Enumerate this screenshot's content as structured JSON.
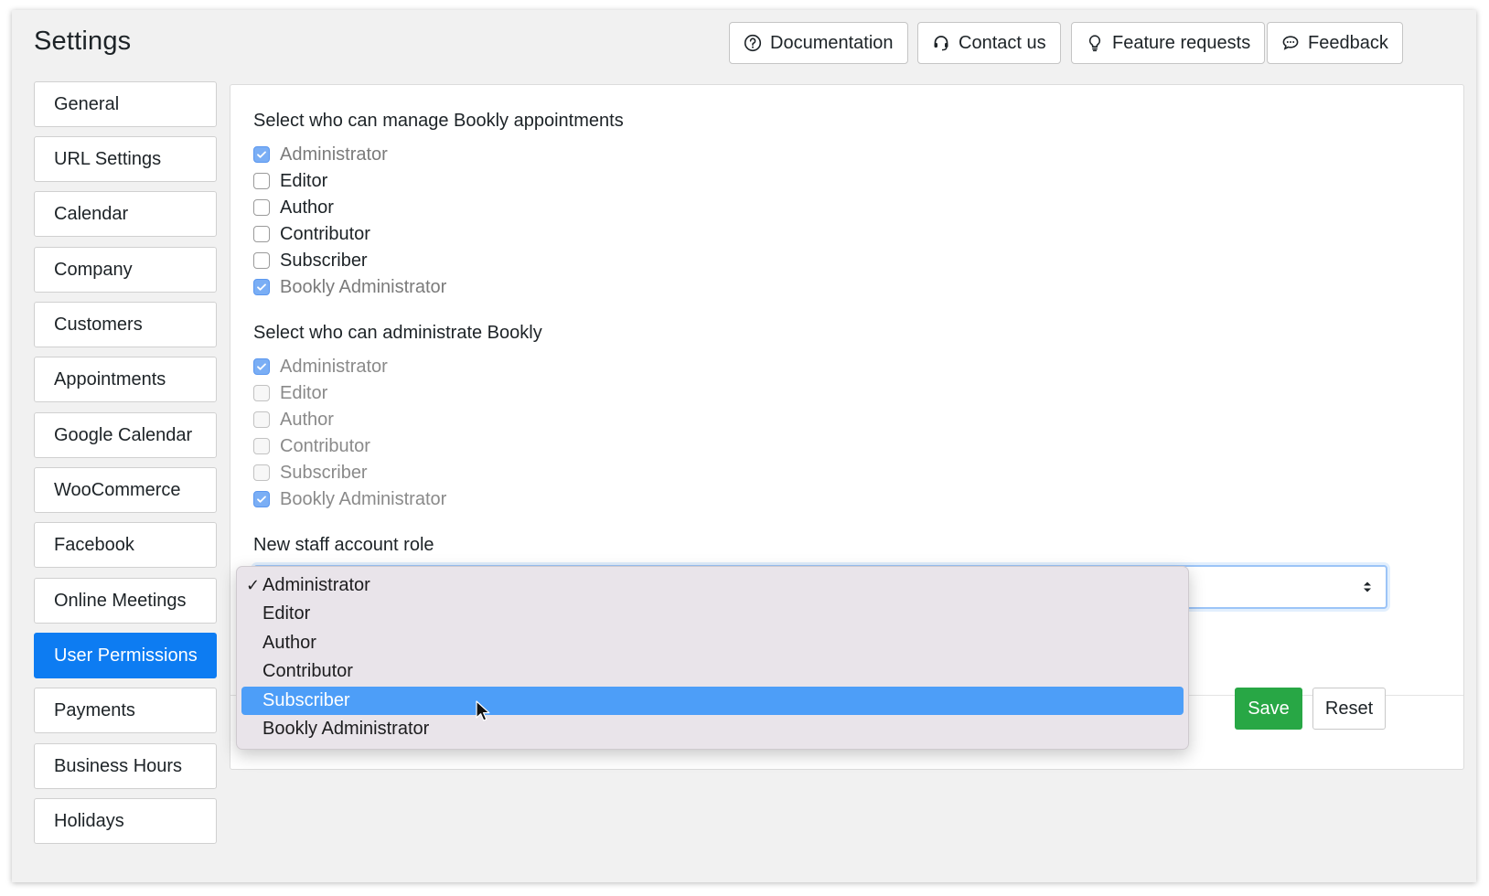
{
  "header": {
    "title": "Settings",
    "buttons": [
      {
        "label": "Documentation",
        "icon": "question-circle-icon"
      },
      {
        "label": "Contact us",
        "icon": "headset-icon"
      },
      {
        "label": "Feature requests",
        "icon": "lightbulb-icon"
      },
      {
        "label": "Feedback",
        "icon": "chat-bubble-icon"
      }
    ]
  },
  "sidebar": {
    "items": [
      {
        "label": "General"
      },
      {
        "label": "URL Settings"
      },
      {
        "label": "Calendar"
      },
      {
        "label": "Company"
      },
      {
        "label": "Customers"
      },
      {
        "label": "Appointments"
      },
      {
        "label": "Google Calendar"
      },
      {
        "label": "WooCommerce"
      },
      {
        "label": "Facebook"
      },
      {
        "label": "Online Meetings"
      },
      {
        "label": "User Permissions",
        "active": true
      },
      {
        "label": "Payments"
      },
      {
        "label": "Business Hours"
      },
      {
        "label": "Holidays"
      }
    ]
  },
  "main": {
    "manage_group": {
      "label": "Select who can manage Bookly appointments",
      "options": [
        {
          "label": "Administrator",
          "checked": true
        },
        {
          "label": "Editor",
          "checked": false
        },
        {
          "label": "Author",
          "checked": false
        },
        {
          "label": "Contributor",
          "checked": false
        },
        {
          "label": "Subscriber",
          "checked": false
        },
        {
          "label": "Bookly Administrator",
          "checked": true
        }
      ]
    },
    "admin_group": {
      "label": "Select who can administrate Bookly",
      "options": [
        {
          "label": "Administrator",
          "checked": true
        },
        {
          "label": "Editor",
          "checked": false
        },
        {
          "label": "Author",
          "checked": false
        },
        {
          "label": "Contributor",
          "checked": false
        },
        {
          "label": "Subscriber",
          "checked": false
        },
        {
          "label": "Bookly Administrator",
          "checked": true
        }
      ]
    },
    "staff_role": {
      "label": "New staff account role",
      "selected": "Administrator",
      "options": [
        "Administrator",
        "Editor",
        "Author",
        "Contributor",
        "Subscriber",
        "Bookly Administrator"
      ],
      "highlighted": "Subscriber",
      "check_glyph": "✓"
    },
    "save_label": "Save",
    "reset_label": "Reset"
  },
  "colors": {
    "accent": "#0d7cf2",
    "save": "#28a745",
    "highlight": "#4d9ef8"
  }
}
